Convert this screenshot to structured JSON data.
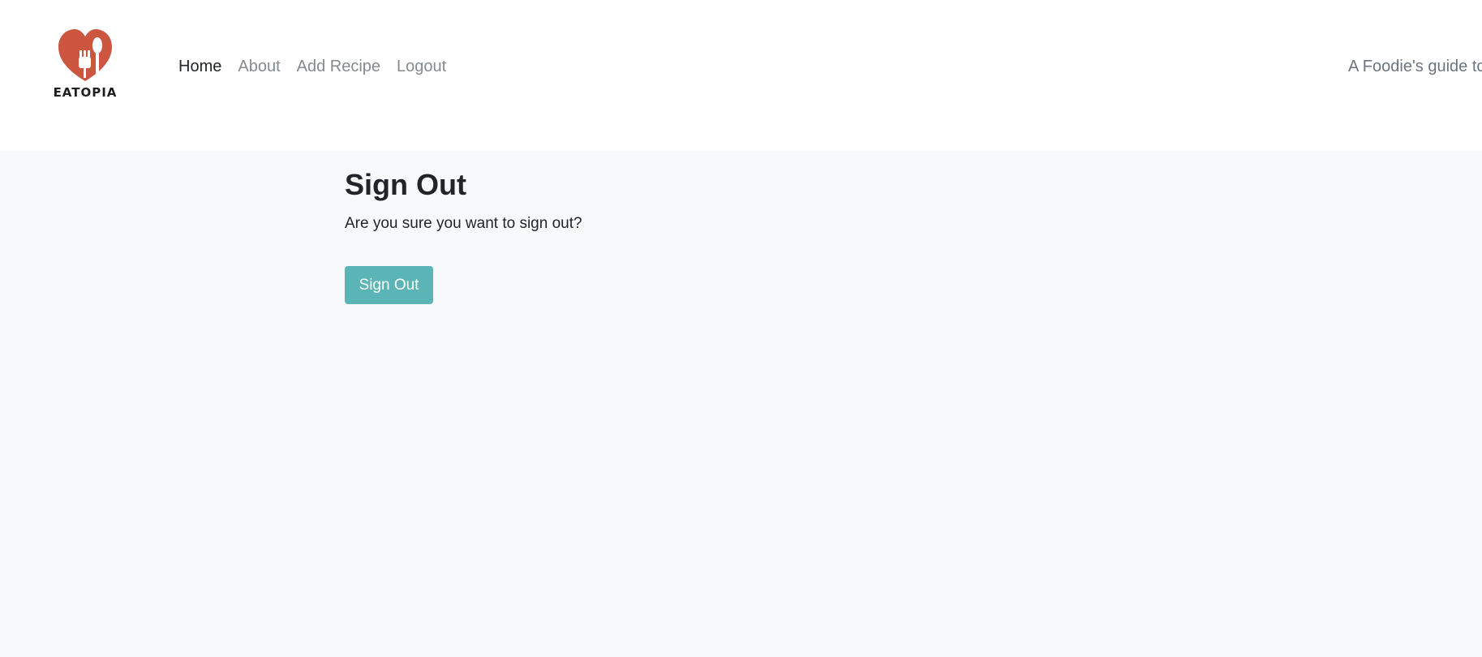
{
  "brand": {
    "name": "EATOPIA",
    "logo_icon": "heart-fork-spoon-icon",
    "logo_color": "#cc5640"
  },
  "nav": {
    "items": [
      {
        "label": "Home",
        "active": true
      },
      {
        "label": "About",
        "active": false
      },
      {
        "label": "Add Recipe",
        "active": false
      },
      {
        "label": "Logout",
        "active": false
      }
    ],
    "tagline": "A Foodie's guide to"
  },
  "main": {
    "title": "Sign Out",
    "text": "Are you sure you want to sign out?",
    "button_label": "Sign Out",
    "button_color": "#5bb5b7"
  }
}
